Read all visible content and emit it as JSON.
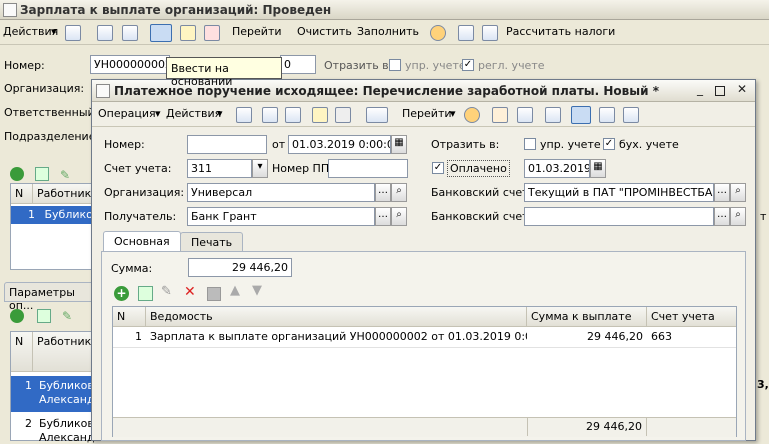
{
  "main": {
    "title": "Зарплата к выплате организаций: Проведен",
    "toolbar": {
      "actions": "Действия",
      "goto": "Перейти",
      "clear": "Очистить",
      "fill": "Заполнить",
      "calc_taxes": "Рассчитать налоги"
    },
    "tooltip": "Ввести на основании",
    "number_label": "Номер:",
    "number_value": "УН000000002",
    "number_suffix": "0",
    "reflect_label": "Отразить в:",
    "upr_label": "упр. учете",
    "regl_label": "регл. учете",
    "org_label": "Организация:",
    "resp_label": "Ответственный:",
    "dept_label": "Подразделение:",
    "col_n": "N",
    "col_worker": "Работник",
    "row1_n": "1",
    "row1_worker": "Бубликов",
    "params_tab": "Параметры оп...",
    "row_a_n": "1",
    "row_a_worker1": "Бубликов",
    "row_a_worker2": "Александ",
    "row_b_n": "2",
    "row_b_worker1": "Бубликов",
    "row_b_worker2": "Александ",
    "right_edge1": "т",
    "right_edge2": "3,1"
  },
  "dialog": {
    "title": "Платежное поручение исходящее: Перечисление заработной платы. Новый *",
    "toolbar": {
      "operation": "Операция",
      "actions": "Действия",
      "goto": "Перейти"
    },
    "number_label": "Номер:",
    "number_value": "",
    "from_label": "от",
    "date_value": "01.03.2019  0:00:00",
    "reflect_label": "Отразить в:",
    "upr_label": "упр. учете",
    "buh_label": "бух. учете",
    "account_label": "Счет учета:",
    "account_value": "311",
    "pp_label": "Номер ПП:",
    "pp_value": "",
    "paid_label": "Оплачено",
    "paid_date": "01.03.2019",
    "org_label": "Организация:",
    "org_value": "Универсал",
    "bank_label": "Банковский счет:",
    "bank_value": "Текущий в ПАТ \"ПРОМІНВЕСТБАНК\"",
    "recipient_label": "Получатель:",
    "recipient_value": "Банк Грант",
    "bank2_label": "Банковский счет:",
    "bank2_value": "",
    "tab_main": "Основная",
    "tab_print": "Печать",
    "sum_label": "Сумма:",
    "sum_value": "29 446,20",
    "table": {
      "headers": [
        "N",
        "Ведомость",
        "Сумма к выплате",
        "Счет учета"
      ],
      "rows": [
        [
          "1",
          "Зарплата к выплате организаций УН000000002 от 01.03.2019 0:00:00",
          "29 446,20",
          "663"
        ]
      ],
      "total": "29 446,20"
    }
  }
}
